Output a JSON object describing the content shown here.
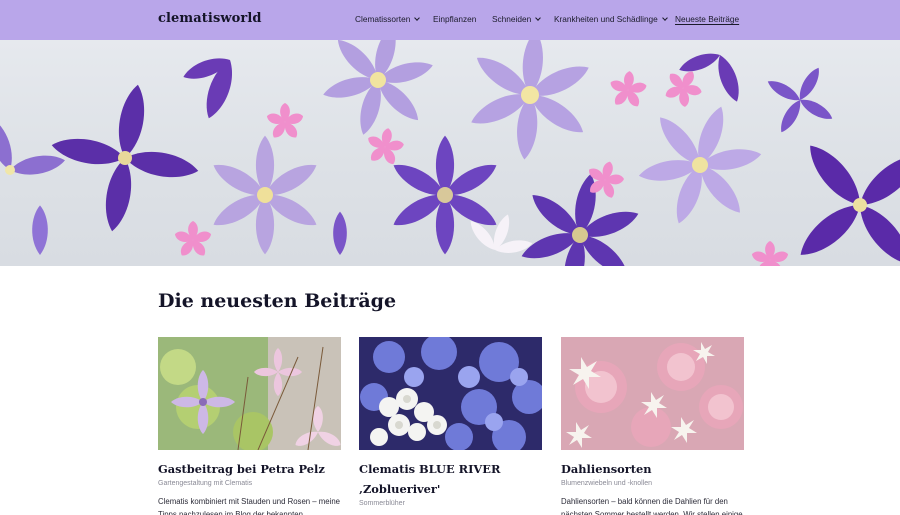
{
  "header": {
    "logo": "clematisworld",
    "nav": [
      {
        "label": "Clematissorten",
        "dropdown": true
      },
      {
        "label": "Einpflanzen",
        "dropdown": false
      },
      {
        "label": "Schneiden",
        "dropdown": true
      },
      {
        "label": "Krankheiten und Schädlinge",
        "dropdown": true
      },
      {
        "label": "Neueste Beiträge",
        "dropdown": false,
        "active": true
      }
    ]
  },
  "hero": {
    "image": "clematis-blossoms-photo"
  },
  "section": {
    "title": "Die neuesten Beiträge",
    "posts": [
      {
        "title": "Gastbeitrag bei Petra Pelz",
        "category": "Gartengestaltung mit Clematis",
        "excerpt": "Clematis kombiniert mit Stauden und Rosen – meine Tipps nachzulesen im Blog der bekannten"
      },
      {
        "title": "Clematis BLUE RIVER ‚Zoblueriver'",
        "category": "Sommerblüher",
        "excerpt": ""
      },
      {
        "title": "Dahliensorten",
        "category": "Blumenzwiebeln und -knollen",
        "excerpt": "Dahliensorten – bald können die Dahlien für den nächsten Sommer bestellt werden. Wir stellen einige"
      }
    ]
  },
  "colors": {
    "header_bg": "#b9a6ea",
    "text_dark": "#141428",
    "category_gray": "#8a8a96"
  }
}
